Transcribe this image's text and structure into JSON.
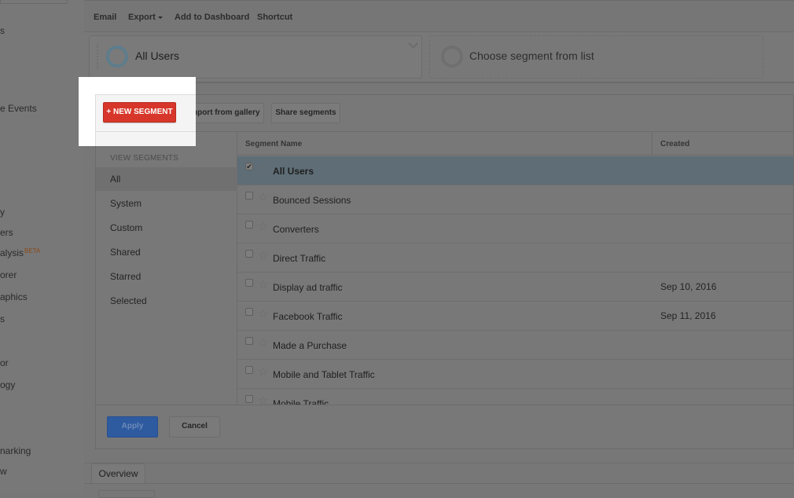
{
  "left_nav": {
    "items": [
      {
        "label": "s"
      },
      {
        "label": "e Events"
      },
      {
        "label": "y"
      },
      {
        "label": "ers"
      },
      {
        "label": "alysis",
        "badge": "BETA"
      },
      {
        "label": "orer"
      },
      {
        "label": "aphics"
      },
      {
        "label": "s"
      },
      {
        "label": "or"
      },
      {
        "label": "ogy"
      },
      {
        "label": "narking"
      },
      {
        "label": "w"
      }
    ]
  },
  "toolbar": {
    "email": "Email",
    "export": "Export",
    "add_to_dashboard": "Add to Dashboard",
    "shortcut": "Shortcut"
  },
  "segments_bar": {
    "selected": "All Users",
    "empty_placeholder": "Choose segment from list"
  },
  "panel": {
    "new_segment": "+ NEW SEGMENT",
    "import_gallery": "Import from gallery",
    "share_segments": "Share segments",
    "view_segments_caption": "VIEW SEGMENTS",
    "views": [
      "All",
      "System",
      "Custom",
      "Shared",
      "Starred",
      "Selected"
    ],
    "active_view": "All",
    "columns": {
      "name": "Segment Name",
      "created": "Created"
    },
    "rows": [
      {
        "name": "All Users",
        "created": "",
        "checked": true
      },
      {
        "name": "Bounced Sessions",
        "created": "",
        "checked": false
      },
      {
        "name": "Converters",
        "created": "",
        "checked": false
      },
      {
        "name": "Direct Traffic",
        "created": "",
        "checked": false
      },
      {
        "name": "Display ad traffic",
        "created": "Sep 10, 2016",
        "checked": false
      },
      {
        "name": "Facebook Traffic",
        "created": "Sep 11, 2016",
        "checked": false
      },
      {
        "name": "Made a Purchase",
        "created": "",
        "checked": false
      },
      {
        "name": "Mobile and Tablet Traffic",
        "created": "",
        "checked": false
      },
      {
        "name": "Mobile Traffic",
        "created": "",
        "checked": false
      }
    ],
    "apply": "Apply",
    "cancel": "Cancel"
  },
  "tabs": {
    "overview": "Overview"
  },
  "colors": {
    "new_segment_red": "#d7372a",
    "apply_blue": "#2e5aa0",
    "selected_row": "#5e6d76"
  }
}
